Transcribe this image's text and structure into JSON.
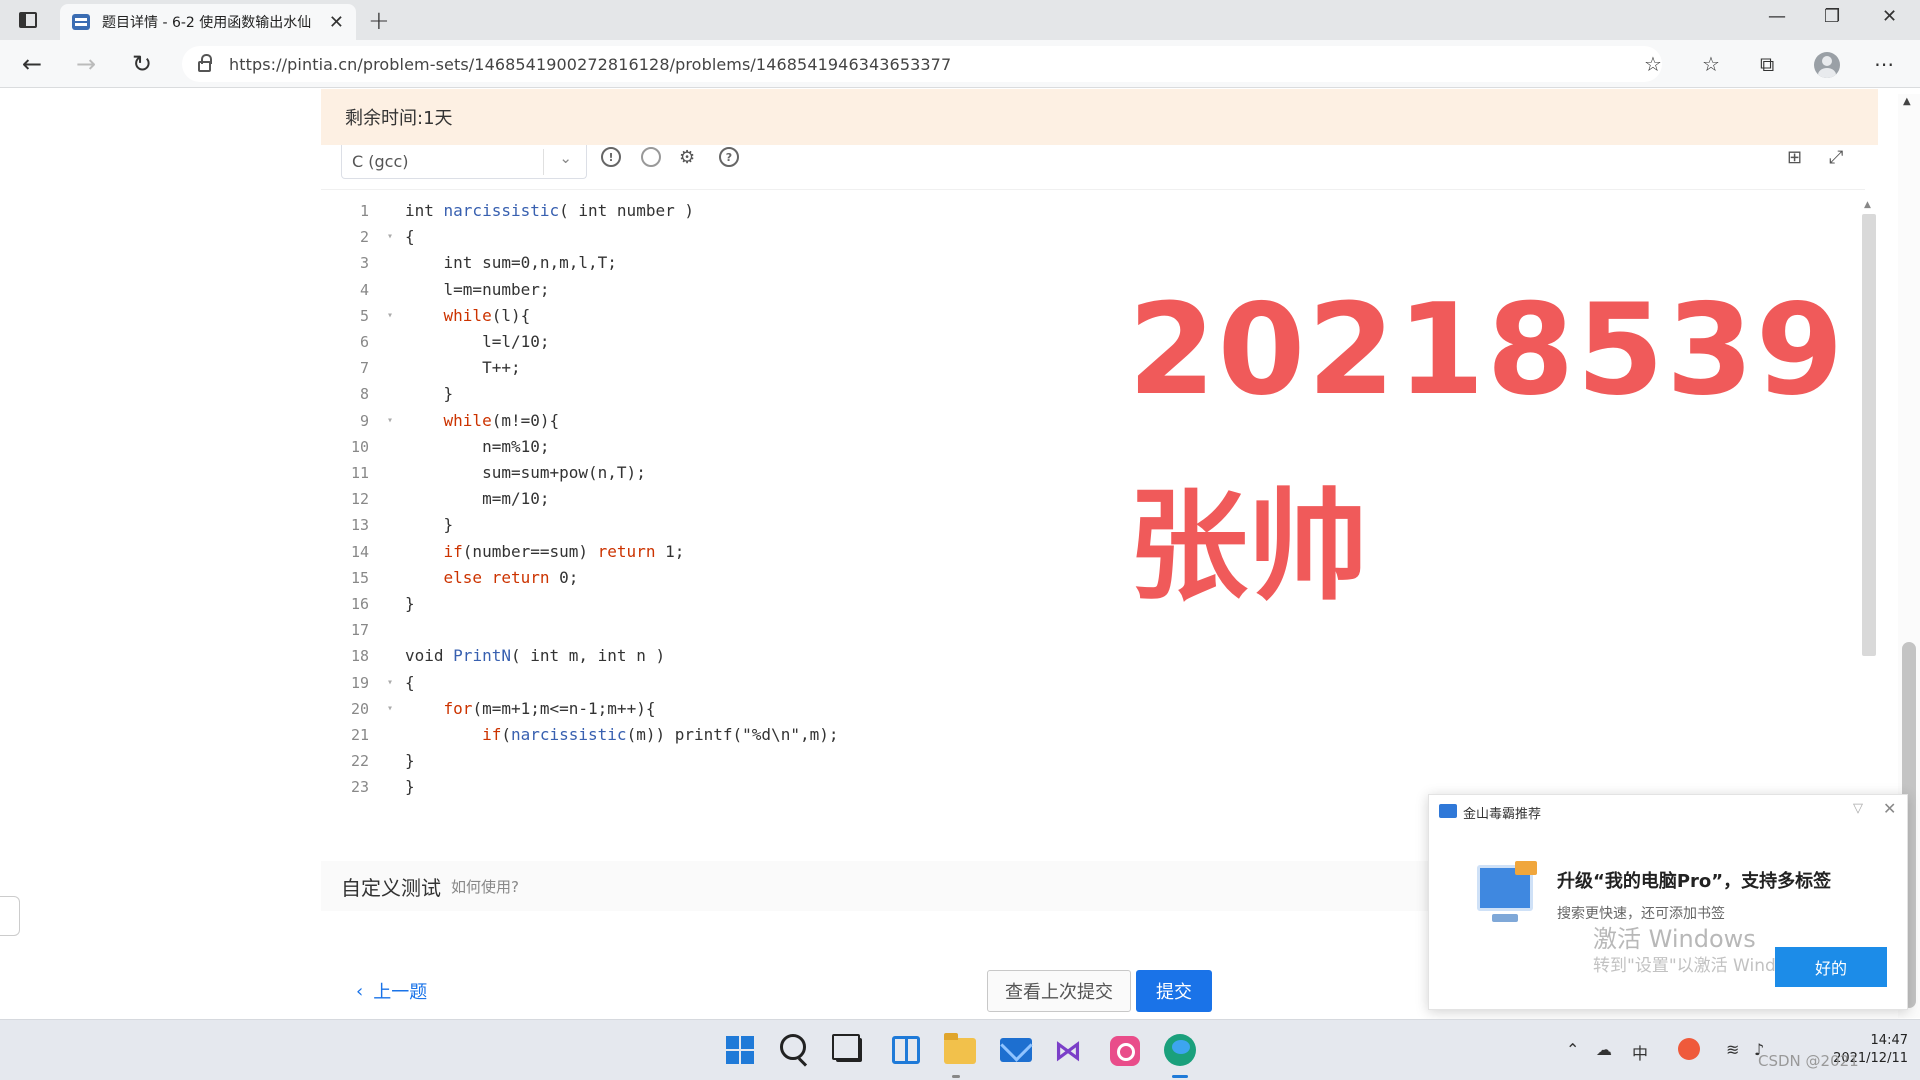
{
  "browser": {
    "tab_title": "题目详情 - 6-2 使用函数输出水仙",
    "url": "https://pintia.cn/problem-sets/1468541900272816128/problems/1468541946343653377"
  },
  "banner": {
    "remaining_time": "剩余时间:1天"
  },
  "editor": {
    "language": "C (gcc)",
    "lines": [
      {
        "n": "1",
        "html": "int narcissistic( int number )"
      },
      {
        "n": "2",
        "html": "{"
      },
      {
        "n": "3",
        "html": "    int sum=0,n,m,l,T;"
      },
      {
        "n": "4",
        "html": "    l=m=number;"
      },
      {
        "n": "5",
        "html": "    while(l){"
      },
      {
        "n": "6",
        "html": "        l=l/10;"
      },
      {
        "n": "7",
        "html": "        T++;"
      },
      {
        "n": "8",
        "html": "    }"
      },
      {
        "n": "9",
        "html": "    while(m!=0){"
      },
      {
        "n": "10",
        "html": "        n=m%10;"
      },
      {
        "n": "11",
        "html": "        sum=sum+pow(n,T);"
      },
      {
        "n": "12",
        "html": "        m=m/10;"
      },
      {
        "n": "13",
        "html": "    }"
      },
      {
        "n": "14",
        "html": "    if(number==sum) return 1;"
      },
      {
        "n": "15",
        "html": "    else return 0;"
      },
      {
        "n": "16",
        "html": "}"
      },
      {
        "n": "17",
        "html": ""
      },
      {
        "n": "18",
        "html": "void PrintN( int m, int n )"
      },
      {
        "n": "19",
        "html": "{"
      },
      {
        "n": "20",
        "html": "    for(m=m+1;m<=n-1;m++){"
      },
      {
        "n": "21",
        "html": "        if(narcissistic(m)) printf(\"%d\\n\",m);"
      },
      {
        "n": "22",
        "html": "}"
      },
      {
        "n": "23",
        "html": "}"
      }
    ],
    "fold_lines": [
      "2",
      "5",
      "9",
      "19",
      "20"
    ]
  },
  "overlay": {
    "student_id": "20218539",
    "student_name": "张帅"
  },
  "custom_test": {
    "title": "自定义测试",
    "help": "如何使用?"
  },
  "actions": {
    "prev": "上一题",
    "history": "查看上次提交",
    "submit": "提交"
  },
  "popup": {
    "header": "金山毒霸推荐",
    "title": "升级“我的电脑Pro”，支持多标签",
    "subtitle": "搜索更快速，还可添加书签",
    "ok": "好的",
    "activate_line1": "激活 Windows",
    "activate_line2": "转到\"设置\"以激活 Windows"
  },
  "taskbar": {
    "time": "14:47",
    "date": "2021/12/11",
    "ime": "中",
    "watermark": "CSDN @2021"
  }
}
